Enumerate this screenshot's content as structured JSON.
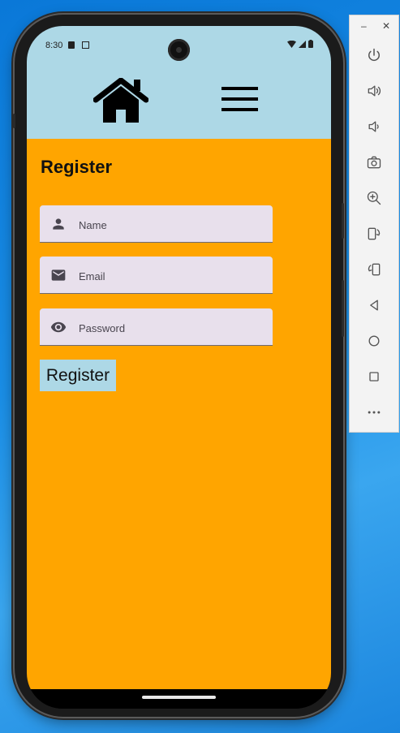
{
  "status_bar": {
    "time": "8:30"
  },
  "page": {
    "title": "Register"
  },
  "form": {
    "name_placeholder": "Name",
    "email_placeholder": "Email",
    "password_placeholder": "Password",
    "register_label": "Register"
  },
  "icons": {
    "header_left": "home-icon",
    "header_right": "hamburger-menu-icon",
    "name_field": "person-icon",
    "email_field": "mail-icon",
    "password_field": "eye-icon"
  },
  "emulator_panel": {
    "controls": [
      "power",
      "volume-up",
      "volume-down",
      "camera",
      "zoom",
      "rotate-left",
      "rotate-right",
      "back",
      "home",
      "overview",
      "more"
    ]
  },
  "colors": {
    "header": "#add8e6",
    "content": "#ffa500",
    "register_button": "#add8e6",
    "field_background": "#e8e0ec"
  }
}
